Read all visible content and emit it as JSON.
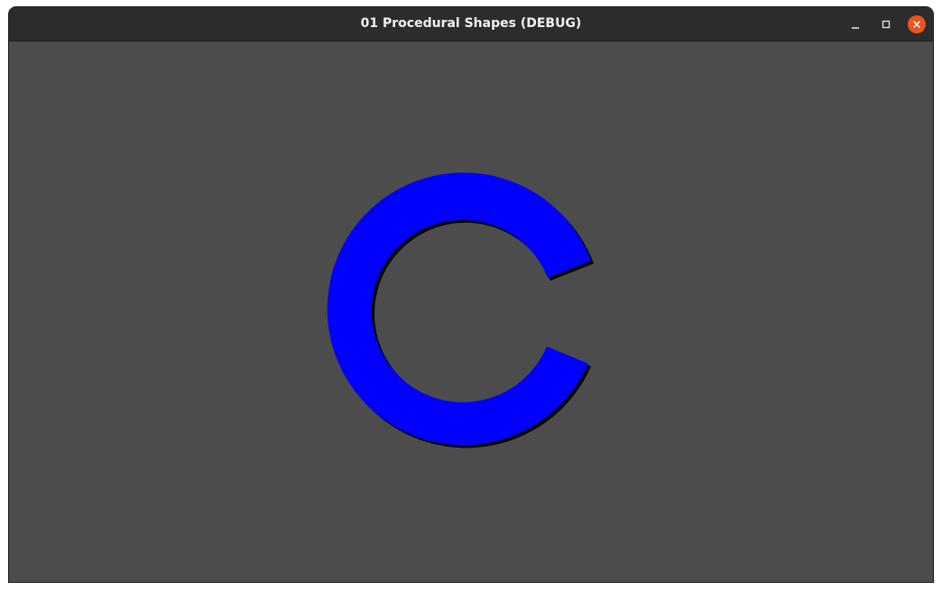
{
  "window": {
    "title": "01 Procedural Shapes (DEBUG)",
    "controls": {
      "minimize_icon": "minimize-icon",
      "maximize_icon": "maximize-icon",
      "close_icon": "close-icon"
    }
  },
  "scene": {
    "background_color": "#4c4c4c",
    "shape": {
      "kind": "ring-arc",
      "fill_color": "#0000ff",
      "shadow_color": "#000000"
    }
  },
  "colors": {
    "titlebar": "#2c2c2c",
    "close_button": "#e95420",
    "title_text": "#f2f2f2"
  }
}
